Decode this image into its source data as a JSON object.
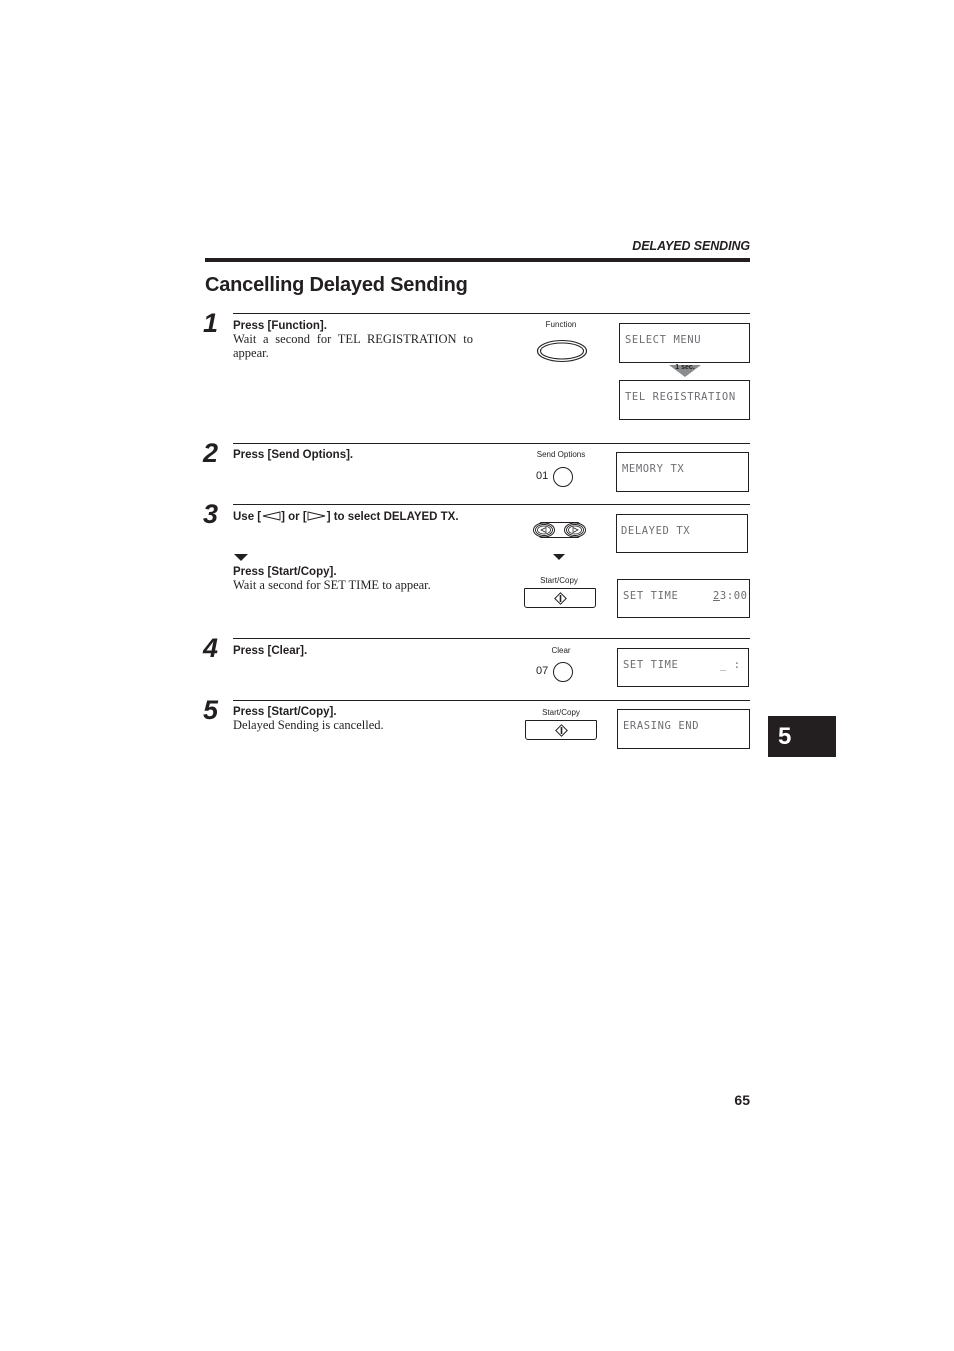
{
  "header": {
    "running_head": "DELAYED SENDING",
    "title": "Cancelling Delayed Sending"
  },
  "steps": [
    {
      "number": "1",
      "instruction": "Press [Function].",
      "detail_line1": "Wait a second for TEL REGISTRATION to",
      "detail_line2": "appear.",
      "key_label": "Function",
      "display_1": "SELECT MENU",
      "transition_label": "1 sec.",
      "display_2": "TEL REGISTRATION"
    },
    {
      "number": "2",
      "instruction": "Press [Send Options].",
      "key_label": "Send Options",
      "key_code": "01",
      "display_1": "MEMORY TX"
    },
    {
      "number": "3",
      "instruction_prefix": "Use [",
      "instruction_mid": "] or [",
      "instruction_suffix": "] to select DELAYED TX.",
      "display_1": "DELAYED TX",
      "sub_instruction": "Press [Start/Copy].",
      "sub_detail": "Wait a second for SET TIME to appear.",
      "sub_key_label": "Start/Copy",
      "display_2_label": "SET TIME",
      "display_2_cursor": "2",
      "display_2_value": "3:00"
    },
    {
      "number": "4",
      "instruction": "Press [Clear].",
      "key_label": "Clear",
      "key_code": "07",
      "display_1": "SET TIME      _ :"
    },
    {
      "number": "5",
      "instruction": "Press [Start/Copy].",
      "detail": "Delayed Sending is cancelled.",
      "key_label": "Start/Copy",
      "display_1": "ERASING END"
    }
  ],
  "chapter_tab": "5",
  "page_number": "65"
}
